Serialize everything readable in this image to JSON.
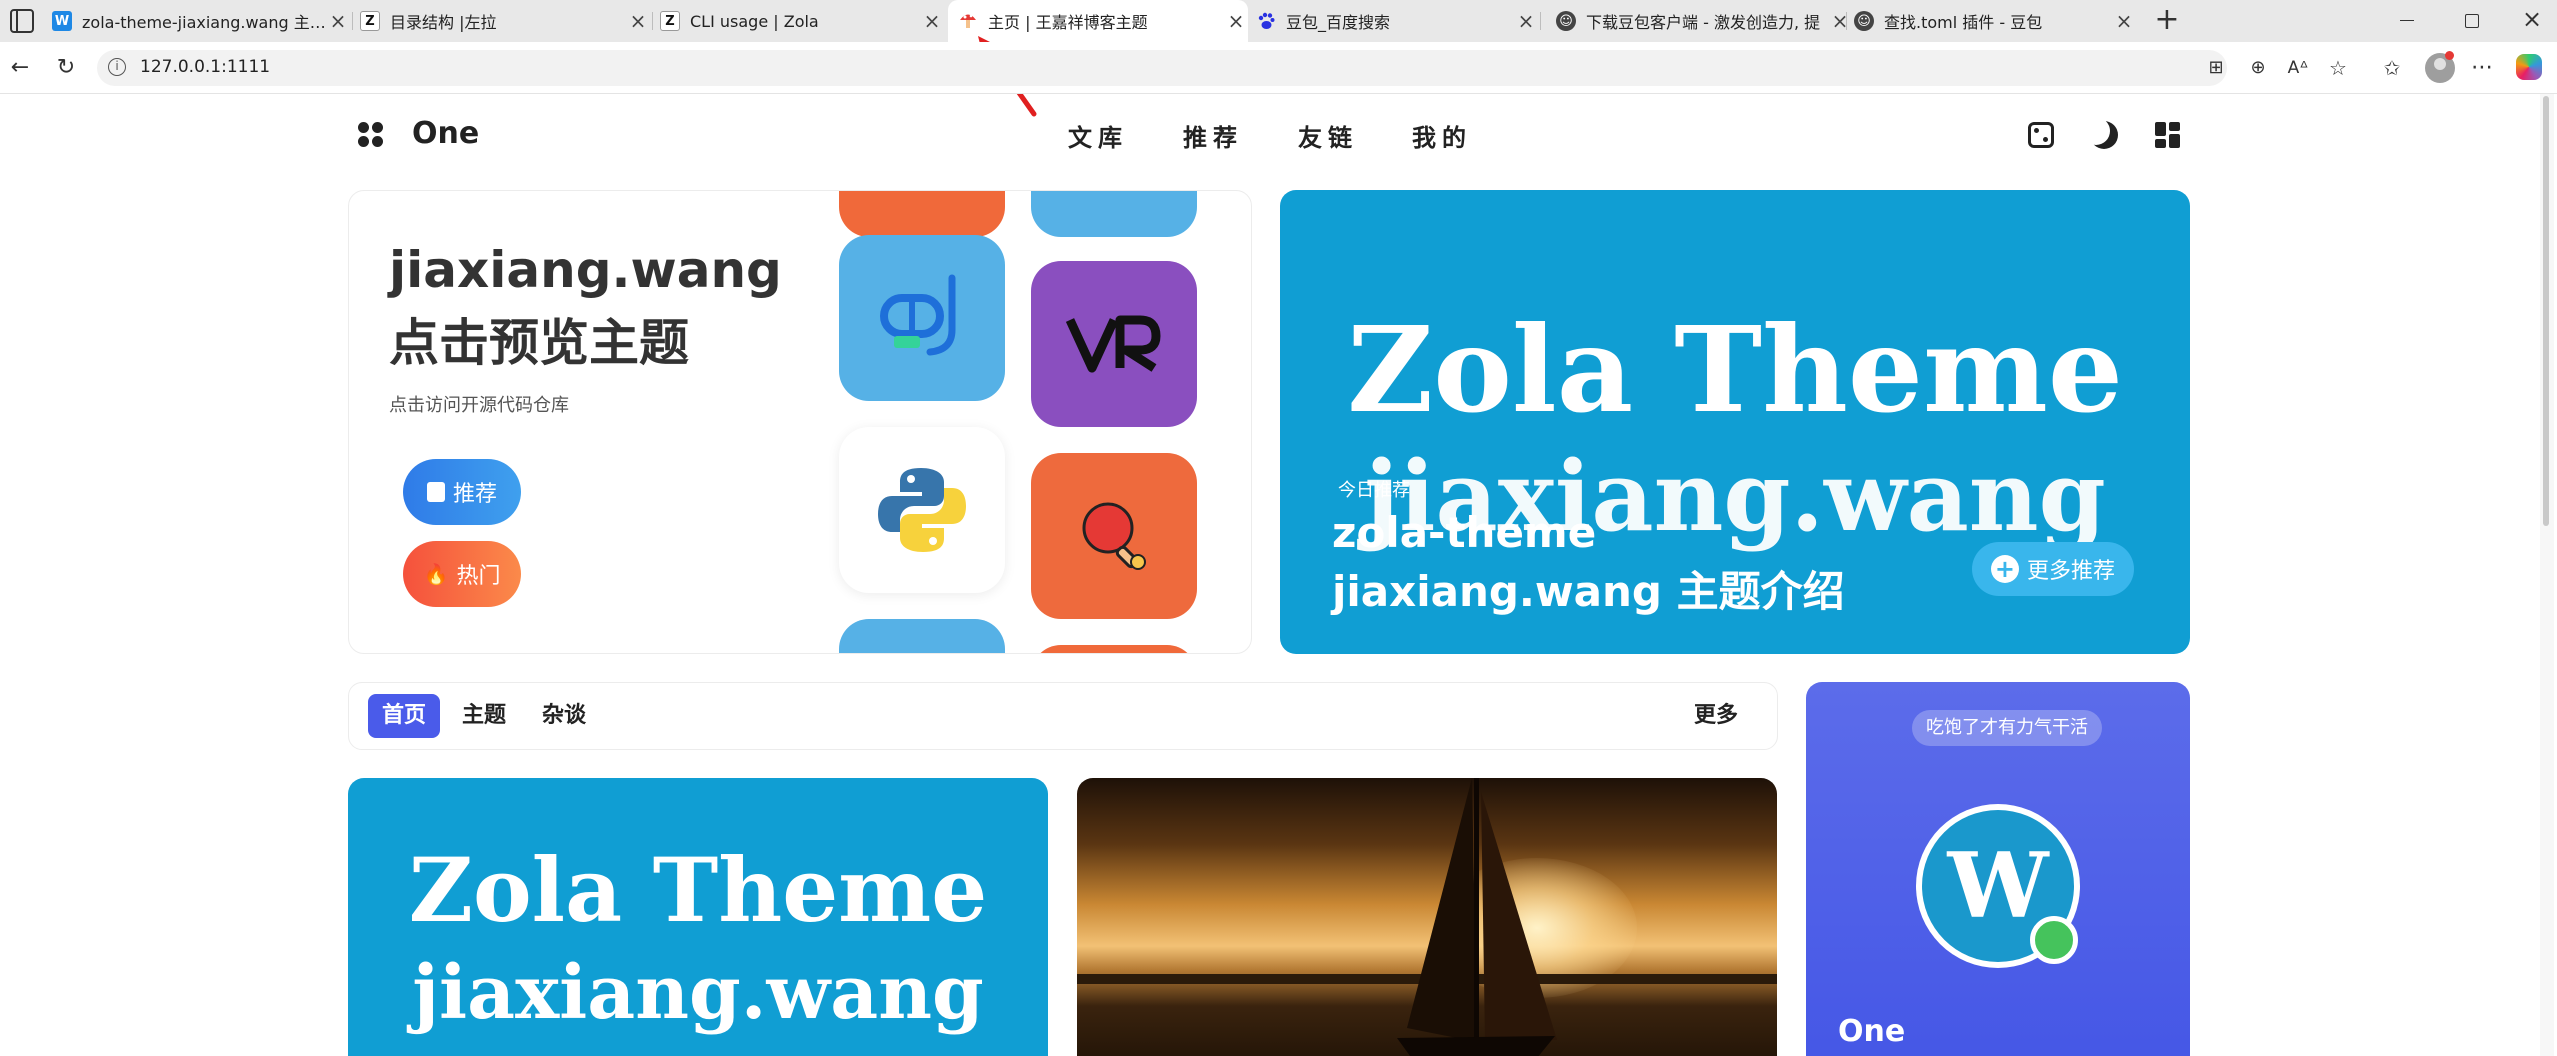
{
  "browser": {
    "tabs": [
      {
        "title": "zola-theme-jiaxiang.wang 主题介绍",
        "icon": "W"
      },
      {
        "title": "目录结构 |左拉",
        "icon": "Z"
      },
      {
        "title": "CLI usage | Zola",
        "icon": "Z"
      },
      {
        "title": "主页 | 王嘉祥博客主题",
        "icon": "mushroom"
      },
      {
        "title": "豆包_百度搜索",
        "icon": "paw"
      },
      {
        "title": "下载豆包客户端 - 激发创造力, 提",
        "icon": "doubao"
      },
      {
        "title": "查找.toml 插件 - 豆包",
        "icon": "doubao"
      }
    ],
    "new_tab": "+",
    "close": "×",
    "url": "127.0.0.1:1111"
  },
  "site": {
    "logo": "One",
    "nav": [
      "文库",
      "推荐",
      "友链",
      "我的"
    ],
    "hero": {
      "title_line1": "jiaxiang.wang",
      "title_line2": "点击预览主题",
      "subtitle": "点击访问开源代码仓库",
      "btn_recommend": "推荐",
      "btn_hot": "热门"
    },
    "feature": {
      "bg_line1": "Zola Theme",
      "bg_line2": "jiaxiang.wang",
      "label": "今日推荐",
      "title_line1": "zola-theme",
      "title_line2": "jiaxiang.wang 主题介绍",
      "more": "更多推荐"
    },
    "filters": [
      "首页",
      "主题",
      "杂谈"
    ],
    "filters_more": "更多",
    "card1": {
      "line1": "Zola Theme",
      "line2": "jiaxiang.wang"
    },
    "profile": {
      "tag": "吃饱了才有力气干活",
      "avatar_letter": "W",
      "name": "One"
    }
  },
  "colors": {
    "accent": "#4a5bea",
    "feature_bg": "#109ed3",
    "profile_bg": "#5265e8"
  }
}
